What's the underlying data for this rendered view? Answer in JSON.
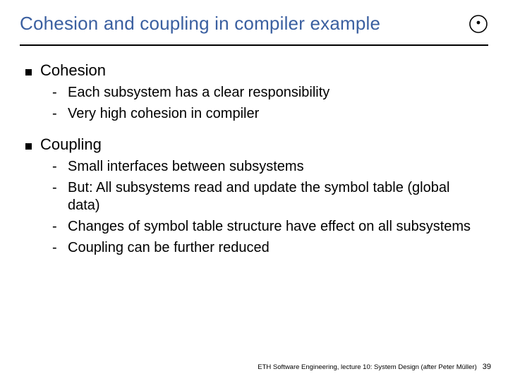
{
  "title": "Cohesion and coupling in compiler example",
  "bullets": [
    {
      "label": "Cohesion",
      "subs": [
        "Each subsystem has a clear responsibility",
        "Very high cohesion in compiler"
      ]
    },
    {
      "label": "Coupling",
      "subs": [
        "Small interfaces between subsystems",
        "But: All subsystems read and update the symbol table (global data)",
        "Changes of symbol table structure have effect on all subsystems",
        "Coupling can be further reduced"
      ]
    }
  ],
  "footer_text": "ETH Software Engineering, lecture 10: System Design (after Peter Müller)",
  "page_number": "39"
}
